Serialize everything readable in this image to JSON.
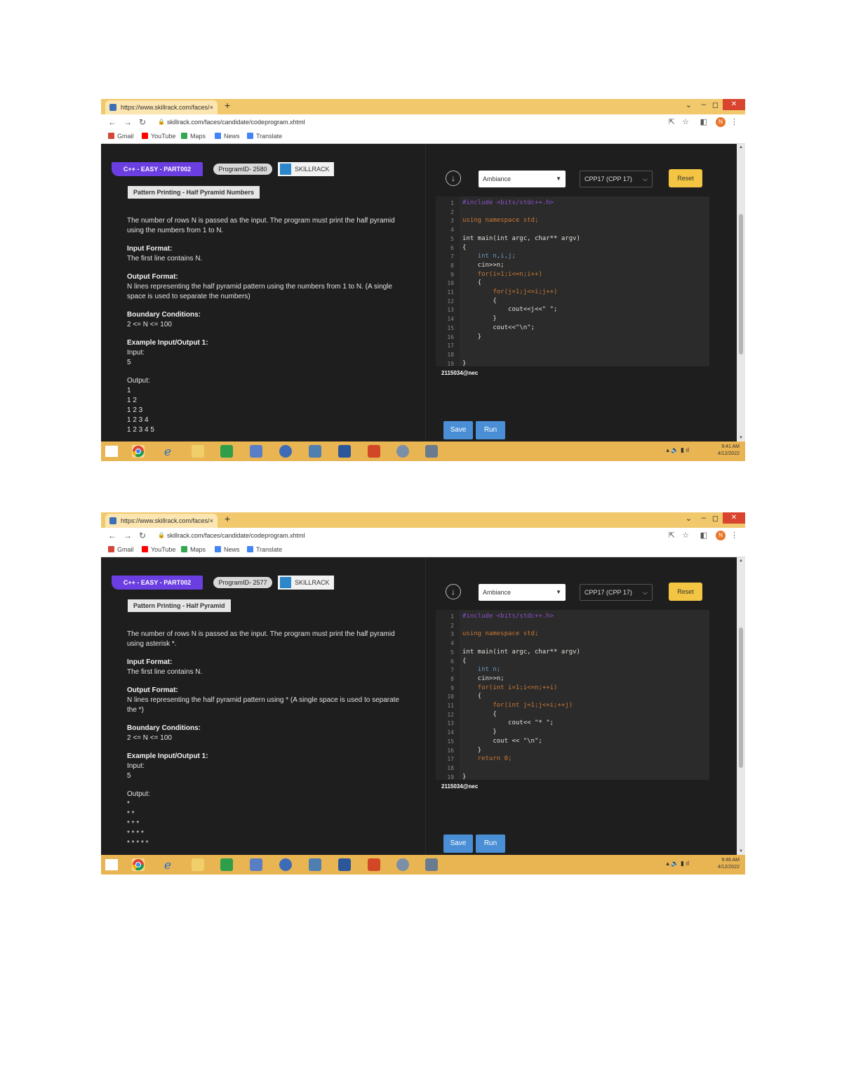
{
  "shots": [
    {
      "browser": {
        "tab_title": "https://www.skillrack.com/faces/",
        "tab_close": "×",
        "new_tab": "+",
        "url": "skillrack.com/faces/candidate/codeprogram.xhtml",
        "bookmarks": [
          "Gmail",
          "YouTube",
          "Maps",
          "News",
          "Translate"
        ],
        "avatar_letter": "N"
      },
      "problem": {
        "title_tag": "C++ - EASY - PART002",
        "program_id": "ProgramID- 2580",
        "brand": "SKILLRACK",
        "name": "Pattern Printing - Half Pyramid Numbers",
        "description": "The number of rows N is passed as the input. The program must print the half pyramid using the numbers from 1 to N.",
        "input_format_label": "Input Format:",
        "input_format": "The first line contains N.",
        "output_format_label": "Output Format:",
        "output_format": "N lines representing the half pyramid pattern using the numbers from 1 to N. (A single space is used to separate the numbers)",
        "boundary_label": "Boundary Conditions:",
        "boundary": "2 <= N <= 100",
        "example_label": "Example Input/Output 1:",
        "input_label": "Input:",
        "input_value": "5",
        "output_label": "Output:",
        "output_lines": [
          "1",
          "1 2",
          "1 2 3",
          "1 2 3 4",
          "1 2 3 4 5"
        ]
      },
      "editor": {
        "theme": "Ambiance",
        "language": "CPP17 (CPP 17)",
        "reset_label": "Reset",
        "line_numbers": [
          "1",
          "2",
          "3",
          "4",
          "5",
          "6",
          "7",
          "8",
          "9",
          "10",
          "11",
          "12",
          "13",
          "14",
          "15",
          "16",
          "17",
          "18",
          "19"
        ],
        "code_lines": [
          "#include <bits/stdc++.h>",
          "",
          "using namespace std;",
          "",
          "int main(int argc, char** argv)",
          "{",
          "    int n,i,j;",
          "    cin>>n;",
          "    for(i=1;i<=n;i++)",
          "    {",
          "        for(j=1;j<=i;j++)",
          "        {",
          "            cout<<j<<\" \";",
          "        }",
          "        cout<<\"\\n\";",
          "    }",
          "",
          "",
          "}"
        ],
        "roll": "2115034@nec",
        "save_label": "Save",
        "run_label": "Run"
      },
      "taskbar": {
        "clock_time": "9:41 AM",
        "clock_date": "4/12/2022"
      }
    },
    {
      "browser": {
        "tab_title": "https://www.skillrack.com/faces/",
        "tab_close": "×",
        "new_tab": "+",
        "url": "skillrack.com/faces/candidate/codeprogram.xhtml",
        "bookmarks": [
          "Gmail",
          "YouTube",
          "Maps",
          "News",
          "Translate"
        ],
        "avatar_letter": "N"
      },
      "problem": {
        "title_tag": "C++ - EASY - PART002",
        "program_id": "ProgramID- 2577",
        "brand": "SKILLRACK",
        "name": "Pattern Printing - Half Pyramid",
        "description": "The number of rows N is passed as the input. The program must print the half pyramid using asterisk *.",
        "input_format_label": "Input Format:",
        "input_format": "The first line contains N.",
        "output_format_label": "Output Format:",
        "output_format": "N lines representing the half pyramid pattern using * (A single space is used to separate the *)",
        "boundary_label": "Boundary Conditions:",
        "boundary": "2 <= N <= 100",
        "example_label": "Example Input/Output 1:",
        "input_label": "Input:",
        "input_value": "5",
        "output_label": "Output:",
        "output_lines": [
          "*",
          "* *",
          "* * *",
          "* * * *",
          "* * * * *"
        ]
      },
      "editor": {
        "theme": "Ambiance",
        "language": "CPP17 (CPP 17)",
        "reset_label": "Reset",
        "line_numbers": [
          "1",
          "2",
          "3",
          "4",
          "5",
          "6",
          "7",
          "8",
          "9",
          "10",
          "11",
          "12",
          "13",
          "14",
          "15",
          "16",
          "17",
          "18",
          "19"
        ],
        "code_lines": [
          "#include <bits/stdc++.h>",
          "",
          "using namespace std;",
          "",
          "int main(int argc, char** argv)",
          "{",
          "    int n;",
          "    cin>>n;",
          "    for(int i=1;i<=n;++i)",
          "    {",
          "        for(int j=1;j<=i;++j)",
          "        {",
          "            cout<< \"* \";",
          "        }",
          "        cout << \"\\n\";",
          "    }",
          "    return 0;",
          "",
          "}"
        ],
        "roll": "2115034@nec",
        "save_label": "Save",
        "run_label": "Run"
      },
      "taskbar": {
        "clock_time": "9:46 AM",
        "clock_date": "4/12/2022"
      }
    }
  ]
}
